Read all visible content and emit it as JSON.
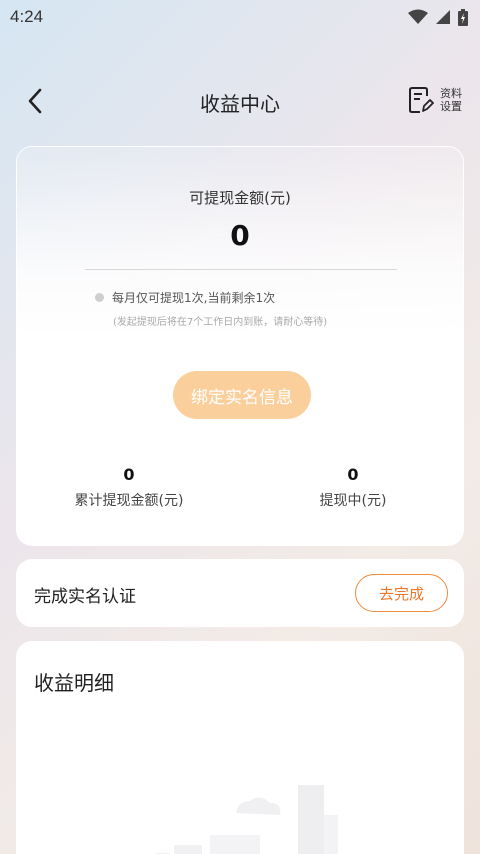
{
  "status_bar": {
    "time": "4:24",
    "wifi_icon": "wifi-icon",
    "signal_icon": "cell-signal-icon",
    "battery_icon": "battery-icon"
  },
  "nav": {
    "title": "收益中心",
    "back_icon": "chevron-left-icon",
    "settings_label": "资料设置",
    "settings_icon": "document-edit-icon"
  },
  "balance_card": {
    "available_label": "可提现金额(元)",
    "available_value": "0",
    "note": "每月仅可提现1次,当前剩余1次",
    "note_sub": "(发起提现后将在7个工作日内到账，请耐心等待)",
    "bind_button": "绑定实名信息",
    "stats": [
      {
        "value": "0",
        "label": "累计提现金额(元)"
      },
      {
        "value": "0",
        "label": "提现中(元)"
      }
    ]
  },
  "verify_card": {
    "label": "完成实名认证",
    "button": "去完成"
  },
  "detail_card": {
    "title": "收益明细"
  },
  "colors": {
    "accent": "#f08a3c",
    "bind_button_bg": "#fbcf9c"
  }
}
